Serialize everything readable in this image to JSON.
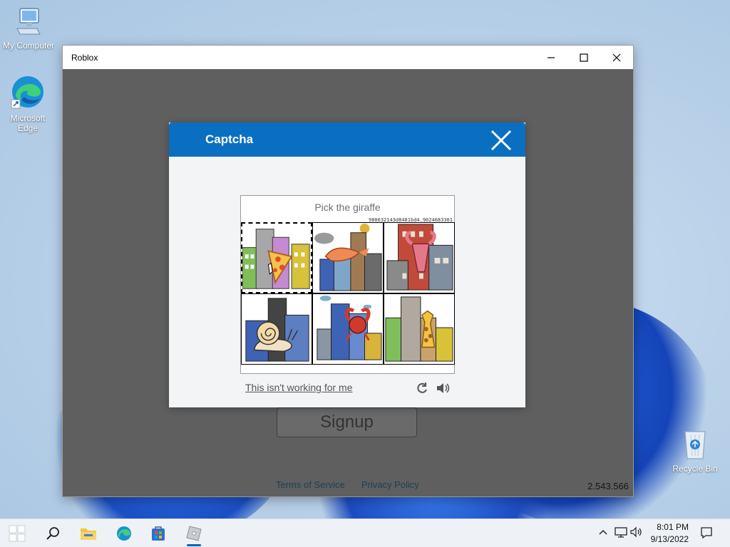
{
  "desktop": {
    "icons": [
      {
        "label": "My Computer",
        "icon": "computer-icon"
      },
      {
        "label": "Microsoft Edge",
        "icon": "edge-icon"
      },
      {
        "label": "Recycle Bin",
        "icon": "recycle-bin-icon"
      }
    ]
  },
  "window": {
    "title": "Roblox",
    "controls": {
      "minimize": "minimize-icon",
      "maximize": "maximize-icon",
      "close": "close-icon"
    },
    "signup_label": "Signup",
    "footer": {
      "terms": "Terms of Service",
      "privacy": "Privacy Policy"
    },
    "version": "2.543.566"
  },
  "captcha": {
    "title": "Captcha",
    "prompt": "Pick the giraffe",
    "token": "980632143d8481bd4.9024683301",
    "tiles": [
      {
        "subject": "pizza slice",
        "selected": true
      },
      {
        "subject": "shrimp",
        "selected": false
      },
      {
        "subject": "lobster",
        "selected": false
      },
      {
        "subject": "snail",
        "selected": false
      },
      {
        "subject": "crab",
        "selected": false
      },
      {
        "subject": "giraffe",
        "selected": false
      }
    ],
    "help_link": "This isn't working for me",
    "icons": {
      "reload": "reload-icon",
      "audio": "audio-icon"
    }
  },
  "taskbar": {
    "items": [
      "start-icon",
      "search-icon",
      "file-explorer-icon",
      "edge-icon",
      "store-icon",
      "roblox-icon"
    ],
    "active": "roblox-icon",
    "time": "8:01 PM",
    "date": "9/13/2022"
  },
  "colors": {
    "captcha_header": "#0b6fc1",
    "window_body": "#5f5f5f",
    "taskbar": "#eef2f6"
  }
}
